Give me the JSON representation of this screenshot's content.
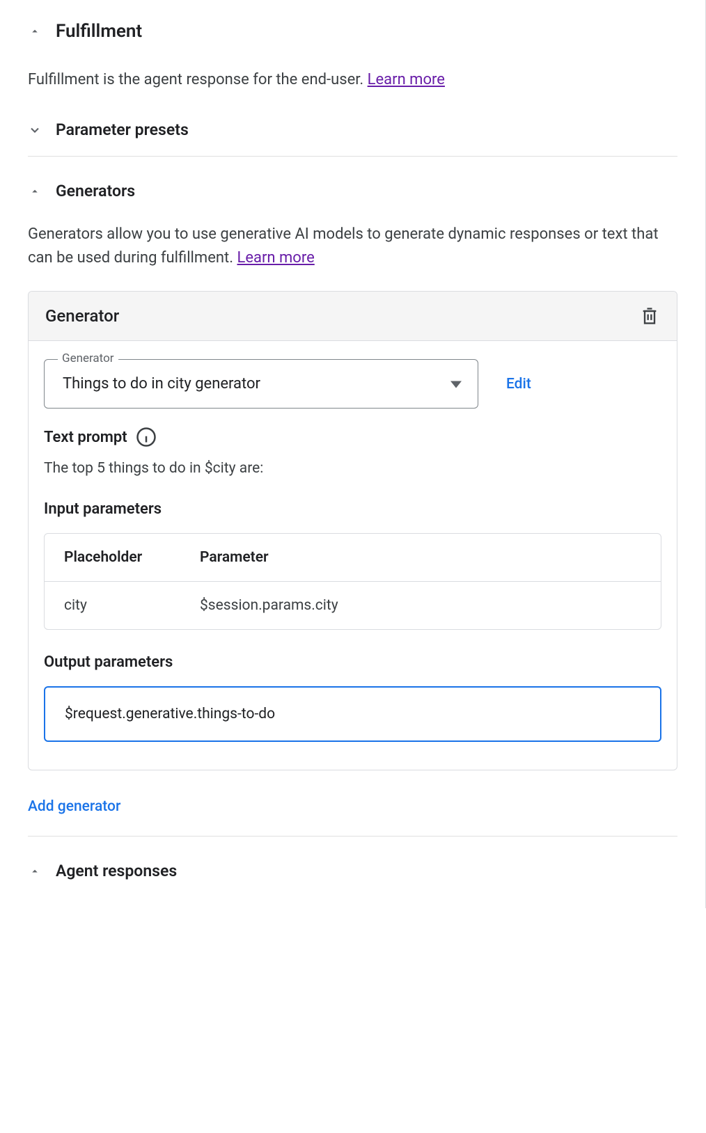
{
  "fulfillment": {
    "title": "Fulfillment",
    "description": "Fulfillment is the agent response for the end-user. ",
    "learn_more": "Learn more"
  },
  "parameter_presets": {
    "title": "Parameter presets"
  },
  "generators": {
    "title": "Generators",
    "description": "Generators allow you to use generative AI models to generate dynamic responses or text that can be used during fulfillment. ",
    "learn_more": "Learn more",
    "card": {
      "title": "Generator",
      "select_label": "Generator",
      "select_value": "Things to do in city generator",
      "edit_label": "Edit",
      "text_prompt_label": "Text prompt",
      "text_prompt_value": "The top 5 things to do in $city are:",
      "input_params_label": "Input parameters",
      "input_table": {
        "headers": {
          "placeholder": "Placeholder",
          "parameter": "Parameter"
        },
        "rows": [
          {
            "placeholder": "city",
            "parameter": "$session.params.city"
          }
        ]
      },
      "output_params_label": "Output parameters",
      "output_value": "$request.generative.things-to-do"
    },
    "add_generator_label": "Add generator"
  },
  "agent_responses": {
    "title": "Agent responses"
  }
}
